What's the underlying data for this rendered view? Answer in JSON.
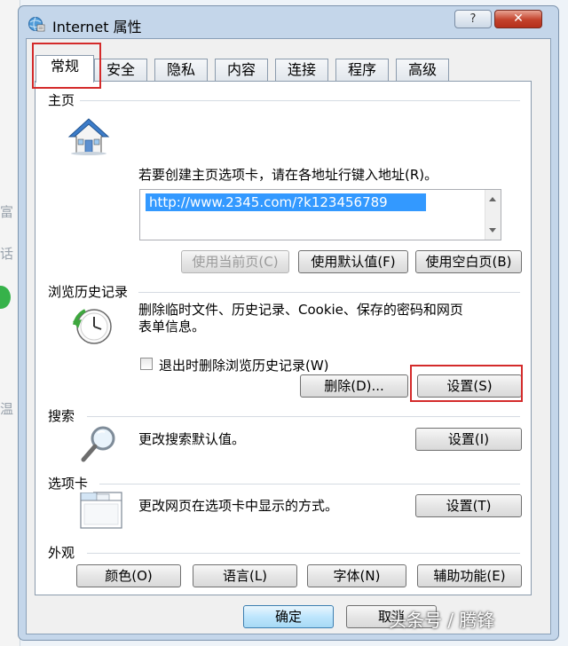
{
  "background": {
    "left_texts": [
      "富",
      "话",
      "温"
    ]
  },
  "window": {
    "title": "Internet 属性",
    "help_glyph": "?",
    "close_glyph": "✕"
  },
  "tabs": [
    {
      "label": "常规",
      "active": true
    },
    {
      "label": "安全",
      "active": false
    },
    {
      "label": "隐私",
      "active": false
    },
    {
      "label": "内容",
      "active": false
    },
    {
      "label": "连接",
      "active": false
    },
    {
      "label": "程序",
      "active": false
    },
    {
      "label": "高级",
      "active": false
    }
  ],
  "home_page": {
    "group_title": "主页",
    "description": "若要创建主页选项卡，请在各地址行键入地址(R)。",
    "url_value": "http://www.2345.com/?k123456789",
    "buttons": {
      "use_current": "使用当前页(C)",
      "use_default": "使用默认值(F)",
      "use_blank": "使用空白页(B)"
    }
  },
  "history": {
    "group_title": "浏览历史记录",
    "description_line1": "删除临时文件、历史记录、Cookie、保存的密码和网页",
    "description_line2": "表单信息。",
    "checkbox_label": "退出时删除浏览历史记录(W)",
    "delete_button": "删除(D)...",
    "settings_button": "设置(S)"
  },
  "search": {
    "group_title": "搜索",
    "description": "更改搜索默认值。",
    "settings_button": "设置(I)"
  },
  "tabs_section": {
    "group_title": "选项卡",
    "description": "更改网页在选项卡中显示的方式。",
    "settings_button": "设置(T)"
  },
  "appearance": {
    "group_title": "外观",
    "buttons": {
      "colors": "颜色(O)",
      "languages": "语言(L)",
      "fonts": "字体(N)",
      "accessibility": "辅助功能(E)"
    }
  },
  "footer": {
    "ok": "确定",
    "cancel": "取消"
  },
  "watermark": "头条号 / 腾锋",
  "colors": {
    "highlight_red": "#d42b2b",
    "frame_blue": "#c4d6ea",
    "selection_blue": "#3399ff"
  }
}
